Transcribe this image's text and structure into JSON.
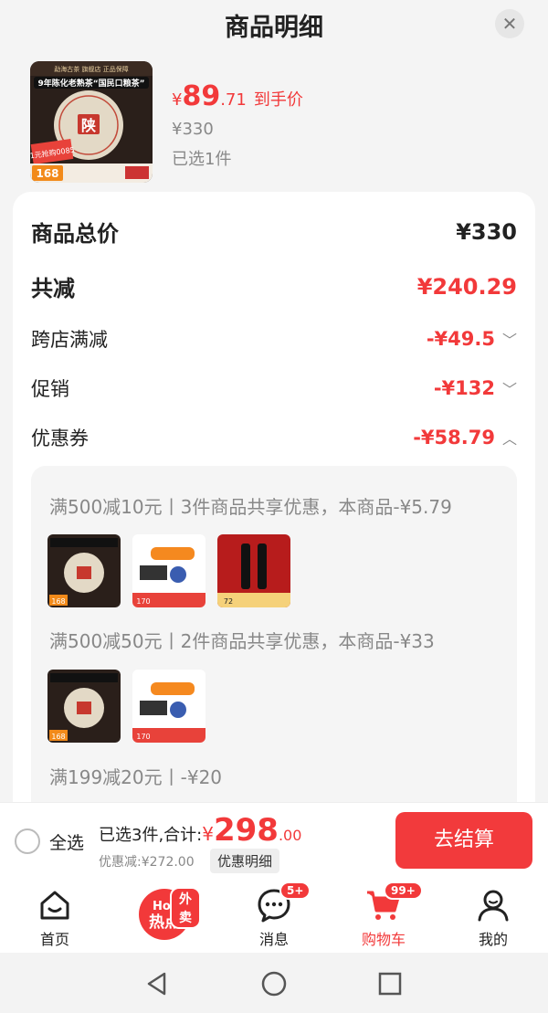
{
  "header": {
    "title": "商品明细",
    "close_icon": "close-icon"
  },
  "product": {
    "price_currency": "¥",
    "price_integer": "89",
    "price_decimal": ".71",
    "price_tag": "到手价",
    "original_price": "¥330",
    "selected_count": "已选1件",
    "image": {
      "top_banner": "9年陈化老熟茶“国民口粮茶”",
      "top_tags": "勐海古茶  旗舰店 正品保障",
      "stamp": "陕",
      "price_tag": "168",
      "promo": "1元抢购0085"
    }
  },
  "summary": {
    "total_label": "商品总价",
    "total_value": "¥330",
    "reduce_label": "共减",
    "reduce_value": "¥240.29",
    "items": [
      {
        "label": "跨店满减",
        "value": "-¥49.5",
        "chevron": "chevron-down-icon"
      },
      {
        "label": "促销",
        "value": "-¥132",
        "chevron": "chevron-down-icon"
      },
      {
        "label": "优惠券",
        "value": "-¥58.79",
        "chevron": "chevron-up-icon"
      }
    ]
  },
  "coupons": [
    {
      "title": "满500减10元丨3件商品共享优惠，本商品-¥5.79",
      "thumbs": [
        "tea",
        "grinder",
        "wine"
      ]
    },
    {
      "title": "满500减50元丨2件商品共享优惠，本商品-¥33",
      "thumbs": [
        "tea",
        "grinder"
      ]
    },
    {
      "title": "满199减20元丨-¥20",
      "thumbs": []
    }
  ],
  "thumb_labels": {
    "tea": "168",
    "grinder": "170",
    "wine": "72"
  },
  "checkout_bar": {
    "select_all": "全选",
    "selected_prefix": "已选3件,合计:",
    "total_currency": "¥",
    "total_integer": "298",
    "total_decimal": ".00",
    "discount": "优惠减:¥272.00",
    "detail_button": "优惠明细",
    "checkout_button": "去结算"
  },
  "tabbar": {
    "items": [
      {
        "label": "首页",
        "icon": "home-icon"
      },
      {
        "label": "",
        "icon": "hot-icon",
        "hot_text": "Hot",
        "hot_main": "热点",
        "badge": "外卖"
      },
      {
        "label": "消息",
        "icon": "message-icon",
        "badge": "5+"
      },
      {
        "label": "购物车",
        "icon": "cart-icon",
        "badge": "99+",
        "active": true
      },
      {
        "label": "我的",
        "icon": "profile-icon"
      }
    ]
  },
  "colors": {
    "accent": "#f2393a",
    "bg": "#f4f4f4"
  }
}
